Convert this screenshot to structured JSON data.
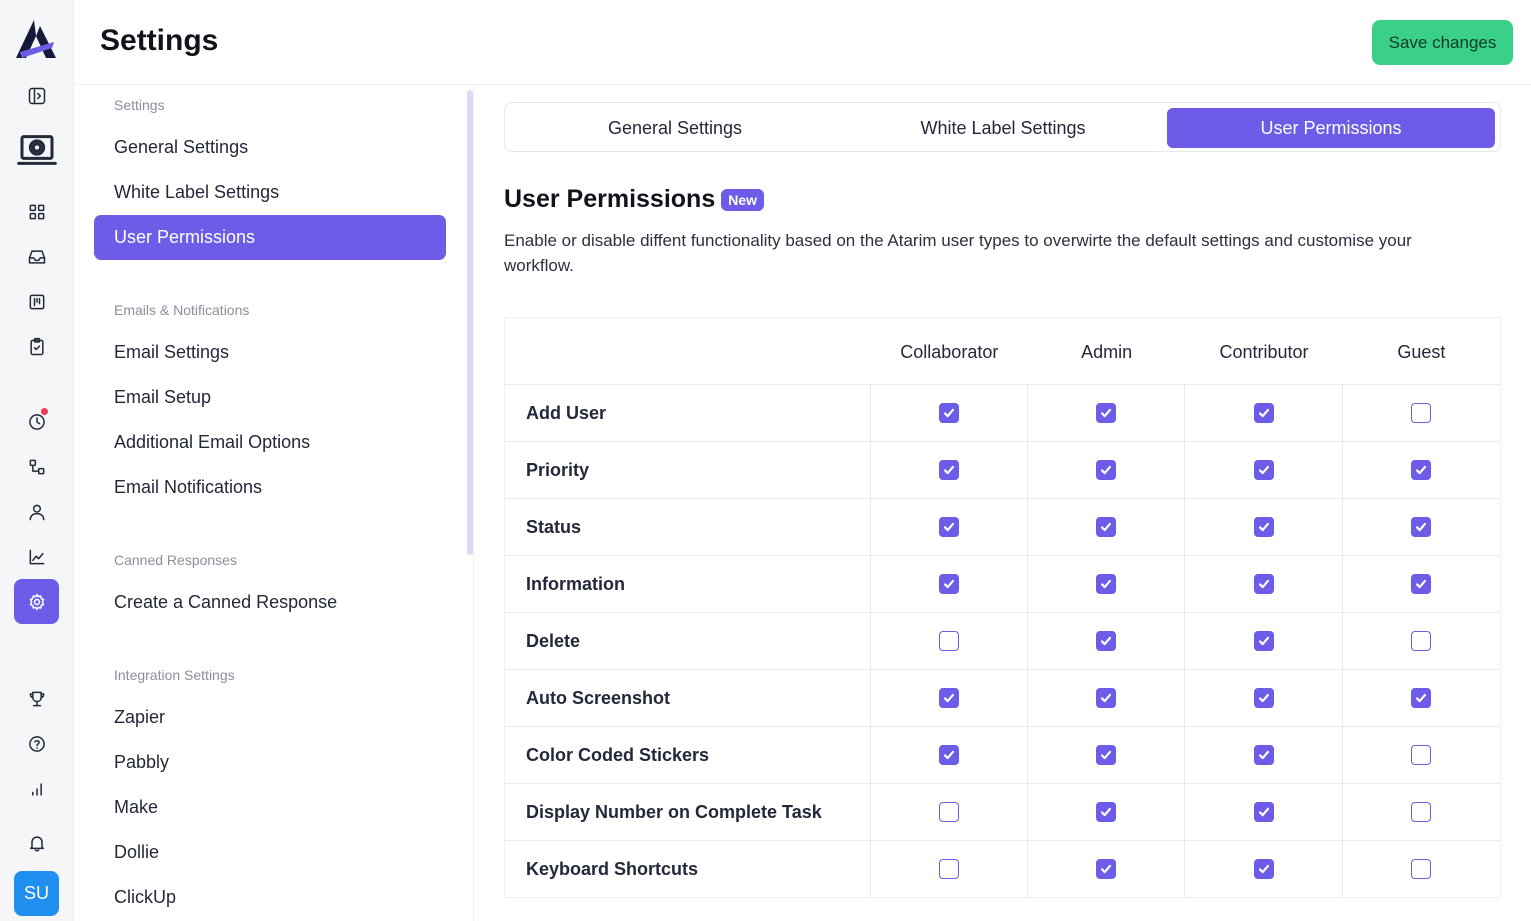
{
  "app": {
    "title": "Settings",
    "save_label": "Save changes",
    "avatar_initials": "SU",
    "accent": "#6c5ce7",
    "save_color": "#3ad08a"
  },
  "rail": {
    "icons": [
      "atarim-logo",
      "sidebar-toggle-icon",
      "settings-laptop-icon",
      "dashboard-grid-icon",
      "inbox-icon",
      "board-icon",
      "clipboard-icon",
      "clock-icon",
      "workflow-icon",
      "user-icon",
      "chart-line-icon",
      "gear-icon",
      "trophy-icon",
      "help-icon",
      "bar-chart-icon",
      "bell-icon"
    ]
  },
  "sidebar": {
    "groups": [
      {
        "title": "Settings",
        "items": [
          "General Settings",
          "White Label Settings",
          "User Permissions"
        ]
      },
      {
        "title": "Emails & Notifications",
        "items": [
          "Email Settings",
          "Email Setup",
          "Additional Email Options",
          "Email Notifications"
        ]
      },
      {
        "title": "Canned Responses",
        "items": [
          "Create a Canned Response"
        ]
      },
      {
        "title": "Integration Settings",
        "items": [
          "Zapier",
          "Pabbly",
          "Make",
          "Dollie",
          "ClickUp"
        ]
      }
    ],
    "active": "User Permissions"
  },
  "tabs": [
    "General Settings",
    "White Label Settings",
    "User Permissions"
  ],
  "section": {
    "title": "User Permissions",
    "badge": "New",
    "description": "Enable or disable diffent functionality based on the Atarim user types to overwirte the default settings and customise your workflow."
  },
  "permissions": {
    "columns": [
      "Collaborator",
      "Admin",
      "Contributor",
      "Guest"
    ],
    "rows": [
      {
        "label": "Add User",
        "values": [
          true,
          true,
          true,
          false
        ]
      },
      {
        "label": "Priority",
        "values": [
          true,
          true,
          true,
          true
        ]
      },
      {
        "label": "Status",
        "values": [
          true,
          true,
          true,
          true
        ]
      },
      {
        "label": "Information",
        "values": [
          true,
          true,
          true,
          true
        ]
      },
      {
        "label": "Delete",
        "values": [
          false,
          true,
          true,
          false
        ]
      },
      {
        "label": "Auto Screenshot",
        "values": [
          true,
          true,
          true,
          true
        ]
      },
      {
        "label": "Color Coded Stickers",
        "values": [
          true,
          true,
          true,
          false
        ]
      },
      {
        "label": "Display Number on Complete Task",
        "values": [
          false,
          true,
          true,
          false
        ]
      },
      {
        "label": "Keyboard Shortcuts",
        "values": [
          false,
          true,
          true,
          false
        ]
      }
    ]
  }
}
